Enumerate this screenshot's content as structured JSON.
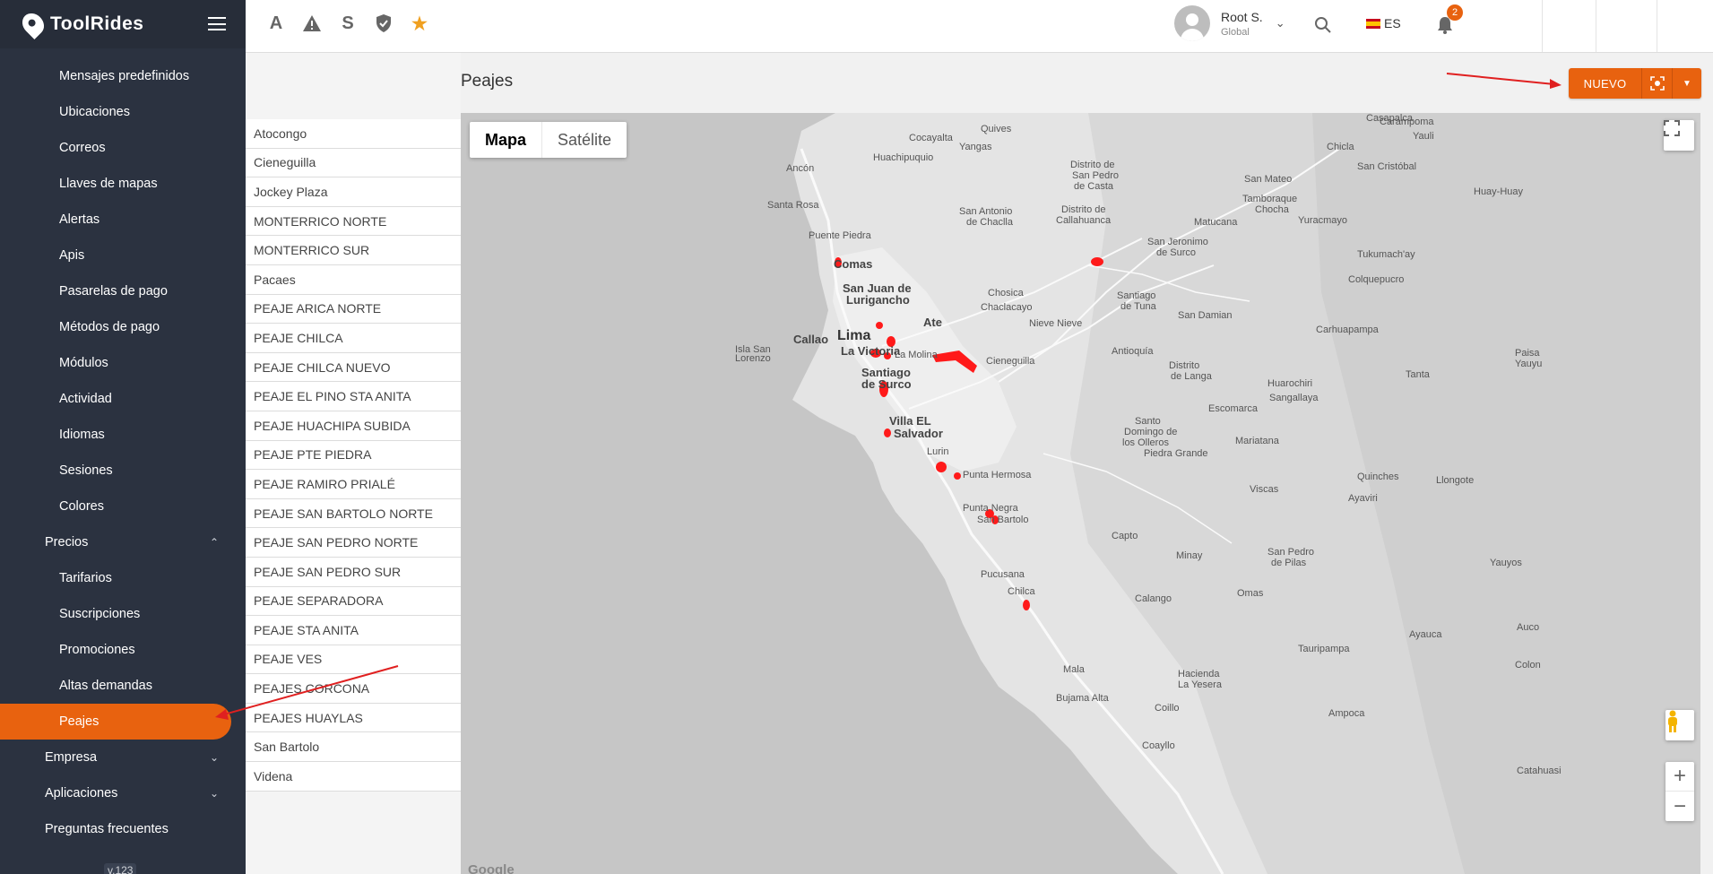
{
  "brand": {
    "name": "ToolRides"
  },
  "sidebar": {
    "items": [
      {
        "label": "Mensajes predefinidos",
        "level": 2
      },
      {
        "label": "Ubicaciones",
        "level": 2
      },
      {
        "label": "Correos",
        "level": 2
      },
      {
        "label": "Llaves de mapas",
        "level": 2
      },
      {
        "label": "Alertas",
        "level": 2
      },
      {
        "label": "Apis",
        "level": 2
      },
      {
        "label": "Pasarelas de pago",
        "level": 2
      },
      {
        "label": "Métodos de pago",
        "level": 2
      },
      {
        "label": "Módulos",
        "level": 2
      },
      {
        "label": "Actividad",
        "level": 2
      },
      {
        "label": "Idiomas",
        "level": 2
      },
      {
        "label": "Sesiones",
        "level": 2
      },
      {
        "label": "Colores",
        "level": 2
      },
      {
        "label": "Precios",
        "level": 1
      },
      {
        "label": "Tarifarios",
        "level": 2
      },
      {
        "label": "Suscripciones",
        "level": 2
      },
      {
        "label": "Promociones",
        "level": 2
      },
      {
        "label": "Altas demandas",
        "level": 2
      },
      {
        "label": "Peajes",
        "level": 2
      },
      {
        "label": "Empresa",
        "level": 1
      },
      {
        "label": "Aplicaciones",
        "level": 1
      },
      {
        "label": "Preguntas frecuentes",
        "level": 1
      }
    ],
    "version": "v.123"
  },
  "topbar": {
    "icons": [
      "A",
      "warning-icon",
      "S",
      "shield-check-icon",
      "star-icon"
    ],
    "user_name": "Root S.",
    "user_role": "Global",
    "language": "ES",
    "notifications": "2"
  },
  "page": {
    "title": "Peajes",
    "new_label": "NUEVO"
  },
  "tolls": [
    "Atocongo",
    "Cieneguilla",
    "Jockey Plaza",
    "MONTERRICO NORTE",
    "MONTERRICO SUR",
    "Pacaes",
    "PEAJE ARICA NORTE",
    "PEAJE CHILCA",
    "PEAJE CHILCA NUEVO",
    "PEAJE EL PINO STA ANITA",
    "PEAJE HUACHIPA SUBIDA",
    "PEAJE PTE PIEDRA",
    "PEAJE RAMIRO PRIALÉ",
    "PEAJE SAN BARTOLO NORTE",
    "PEAJE SAN PEDRO NORTE",
    "PEAJE SAN PEDRO SUR",
    "PEAJE SEPARADORA",
    "PEAJE STA ANITA",
    "PEAJE VES",
    "PEAJES CORCONA",
    "PEAJES HUAYLAS",
    "San Bartolo",
    "Videna"
  ],
  "map": {
    "type_map": "Mapa",
    "type_satellite": "Satélite",
    "attribution": "Google",
    "labels": {
      "l1": "Carampoma",
      "l2": "Quives",
      "l3": "Cocayalta",
      "l4": "Yangas",
      "l5": "Huachipuquio",
      "l6": "Ancón",
      "l7": "Santa Rosa",
      "l8": "Puente Piedra",
      "l9": "Comas",
      "l10": "San Juan de",
      "l11": "Lurigancho",
      "l12": "Callao",
      "l13": "Lima",
      "l14": "La Victoria",
      "l15": "Ate",
      "l16": "Santiago",
      "l17": "de Surco",
      "l18": "Villa EL",
      "l19": "Salvador",
      "l20": "Lurin",
      "l21": "Punta Hermosa",
      "l22": "Punta Negra",
      "l23": "San Bartolo",
      "l24": "Pucusana",
      "l25": "Chilca",
      "l26": "Mala",
      "l27": "Bujama Alta",
      "l28": "Cieneguilla",
      "l29": "Chosica",
      "l30": "Chaclacayo",
      "l31": "Nieve Nieve",
      "l32": "Antioquía",
      "l33": "Santiago",
      "l34": "de Tuna",
      "l35": "Distrito de",
      "l36": "San Pedro",
      "l37": "de Casta",
      "l38": "Distrito de",
      "l39": "Callahuanca",
      "l40": "San Antonio",
      "l41": "de Chaclla",
      "l42": "Matucana",
      "l43": "San Mateo",
      "l44": "San Cristóbal",
      "l45": "Huay-Huay",
      "l46": "Yauli",
      "l47": "Chicla",
      "l48": "Casapalca",
      "l49": "Tamboraque",
      "l50": "Chocha",
      "l51": "Yuracmayo",
      "l52": "San Jeronimo",
      "l53": "de Surco",
      "l54": "Tukumach'ay",
      "l55": "Colquepucro",
      "l56": "San Damian",
      "l57": "Carhuapampa",
      "l58": "Tanta",
      "l59": "Huarochiri",
      "l60": "Sangallaya",
      "l61": "Escomarca",
      "l62": "Santo",
      "l63": "Domingo de",
      "l64": "los Olleros",
      "l65": "Piedra Grande",
      "l66": "Mariatana",
      "l67": "Quinches",
      "l68": "Llongote",
      "l69": "Viscas",
      "l70": "Ayaviri",
      "l71": "Capto",
      "l72": "Minay",
      "l73": "San Pedro",
      "l74": "de Pilas",
      "l75": "Yauyos",
      "l76": "Omas",
      "l77": "Calango",
      "l78": "Ayauca",
      "l79": "Tauripampa",
      "l80": "Hacienda",
      "l81": "La Yesera",
      "l82": "Coillo",
      "l83": "Ampoca",
      "l84": "Coayllo",
      "l85": "Isla San",
      "l86": "Lorenzo",
      "l87": "La Molina",
      "l88": "Distrito",
      "l89": "de Langa",
      "l90": "Colon",
      "l91": "Catahuasi",
      "l92": "Paisa",
      "l93": "Yauyu",
      "l94": "Auco"
    }
  }
}
